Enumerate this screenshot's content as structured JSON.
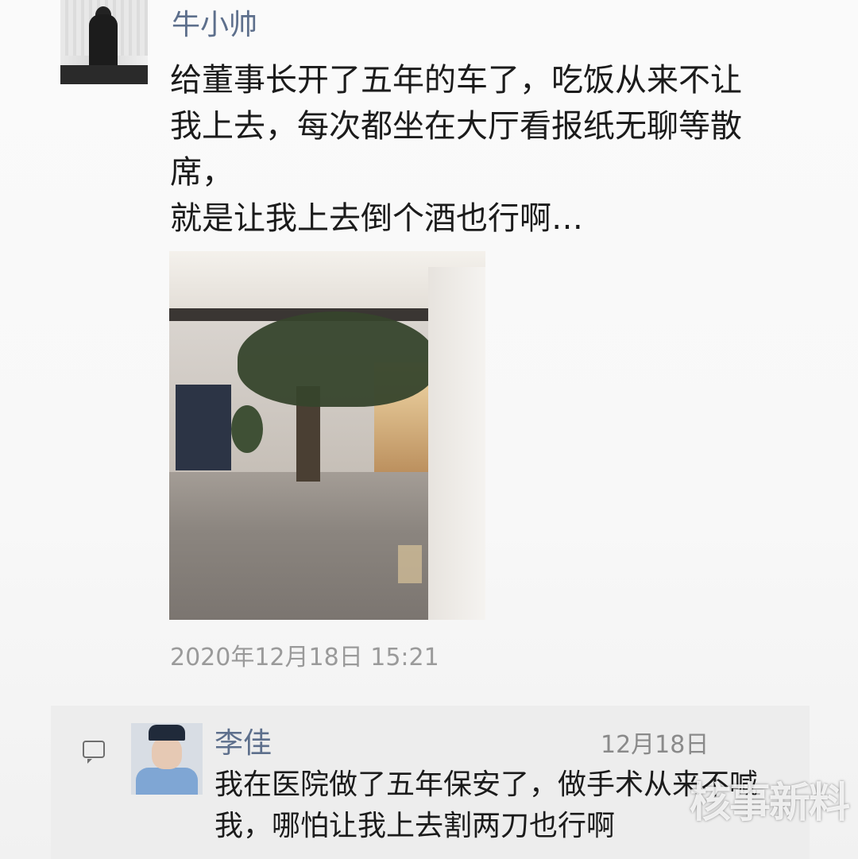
{
  "post": {
    "author": "牛小帅",
    "text_lines": [
      "给董事长开了五年的车了，吃饭从来不让",
      "我上去，每次都坐在大厅看报纸无聊等散",
      "席，",
      "就是让我上去倒个酒也行啊…"
    ],
    "timestamp": "2020年12月18日  15:21"
  },
  "comments": [
    {
      "author": "李佳",
      "date": "12月18日",
      "text_lines": [
        "我在医院做了五年保安了，做手术从来不喊",
        "我，哪怕让我上去割两刀也行啊"
      ]
    }
  ],
  "watermark": "核事新料",
  "icons": {
    "comment": "speech-bubble-icon"
  }
}
